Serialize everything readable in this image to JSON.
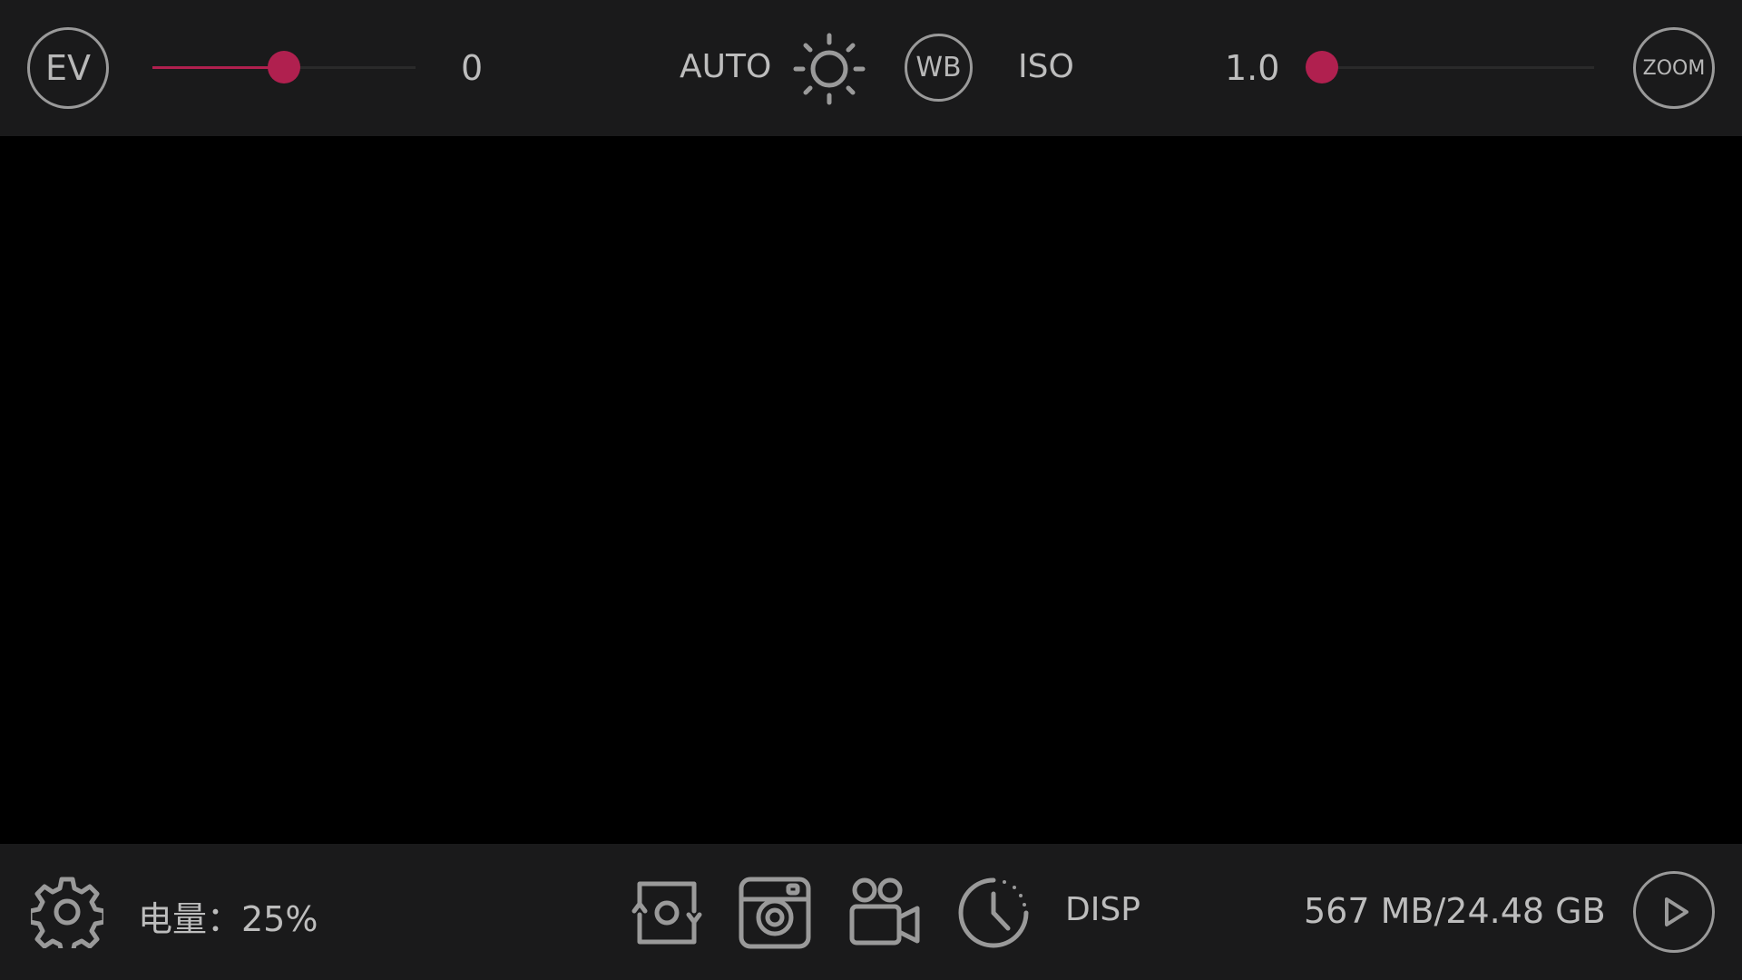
{
  "colors": {
    "accent": "#b0204f",
    "bar_bg": "#1a1a1b",
    "icon": "#9a9a9a",
    "text": "#bdbdbd"
  },
  "top_bar": {
    "ev": {
      "label": "EV",
      "value": "0",
      "slider_level": 0.5
    },
    "exposure_mode": "AUTO",
    "brightness_icon": "sun-icon",
    "wb_label": "WB",
    "iso_label": "ISO",
    "zoom": {
      "value": "1.0",
      "slider_level": 0.0,
      "label": "ZOOM"
    }
  },
  "bottom_bar": {
    "settings_icon": "gear-icon",
    "battery_text": "电量：25%",
    "switch_camera_icon": "switch-camera-icon",
    "photo_icon": "camera-icon",
    "video_icon": "video-camera-icon",
    "timer_icon": "timer-icon",
    "disp_label": "DISP",
    "storage_text": "567 MB/24.48 GB",
    "playback_icon": "play-icon"
  }
}
